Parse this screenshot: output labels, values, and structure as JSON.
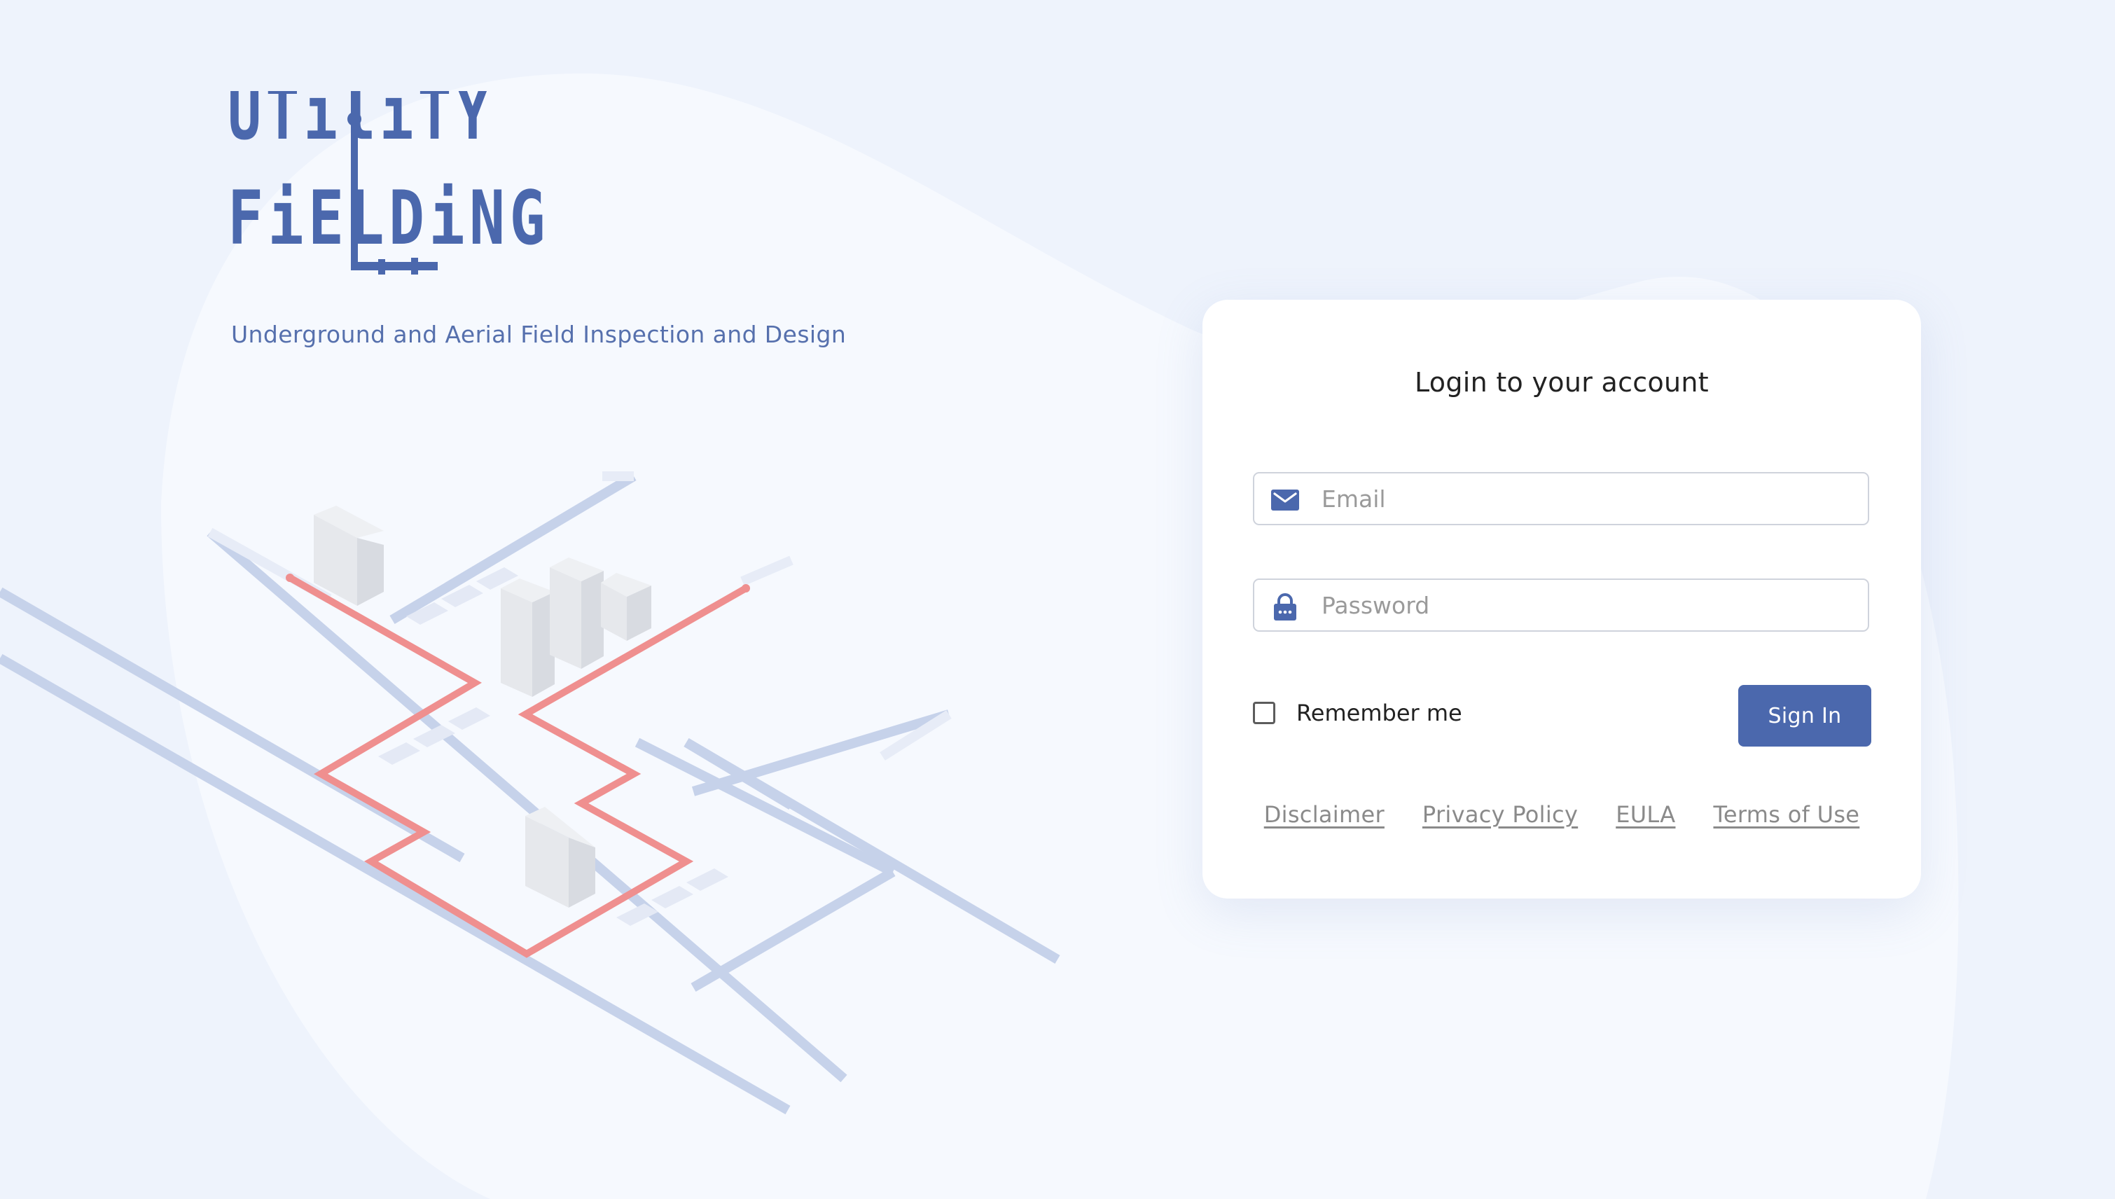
{
  "brand": {
    "logo_line1": "UTiliTY",
    "logo_line2": "FiELDiNG",
    "tagline": "Underground and Aerial Field Inspection and Design",
    "color": "#4b68ad"
  },
  "login": {
    "title": "Login to your account",
    "email": {
      "placeholder": "Email",
      "value": "",
      "icon": "envelope-icon"
    },
    "password": {
      "placeholder": "Password",
      "value": "",
      "icon": "lock-icon"
    },
    "remember_label": "Remember me",
    "remember_checked": false,
    "signin_label": "Sign In"
  },
  "footer_links": [
    "Disclaimer",
    "Privacy Policy",
    "EULA",
    "Terms of Use"
  ],
  "colors": {
    "accent": "#4b68ad",
    "page_bg": "#eef3fc",
    "pipe_red": "#ef8f8f",
    "street": "#c6d2ea"
  }
}
